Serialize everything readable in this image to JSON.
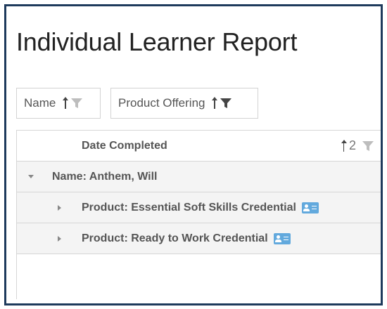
{
  "report": {
    "title": "Individual Learner Report"
  },
  "filter_chips": [
    {
      "label": "Name",
      "sort": "ascending",
      "icon": "filter-icon"
    },
    {
      "label": "Product Offering",
      "sort": "ascending",
      "icon": "filter-icon"
    }
  ],
  "grid": {
    "header": {
      "label": "Date Completed",
      "sort_order": "2"
    },
    "group": {
      "label": "Name: Anthem, Will",
      "expanded": true
    },
    "rows": [
      {
        "label": "Product: Essential Soft Skills Credential",
        "icon": "credential-card-icon"
      },
      {
        "label": "Product: Ready to Work Credential",
        "icon": "credential-card-icon"
      }
    ]
  },
  "colors": {
    "frame_border": "#1e3a5c",
    "badge": "#62a9dd",
    "group_bg": "#f4f4f4"
  }
}
